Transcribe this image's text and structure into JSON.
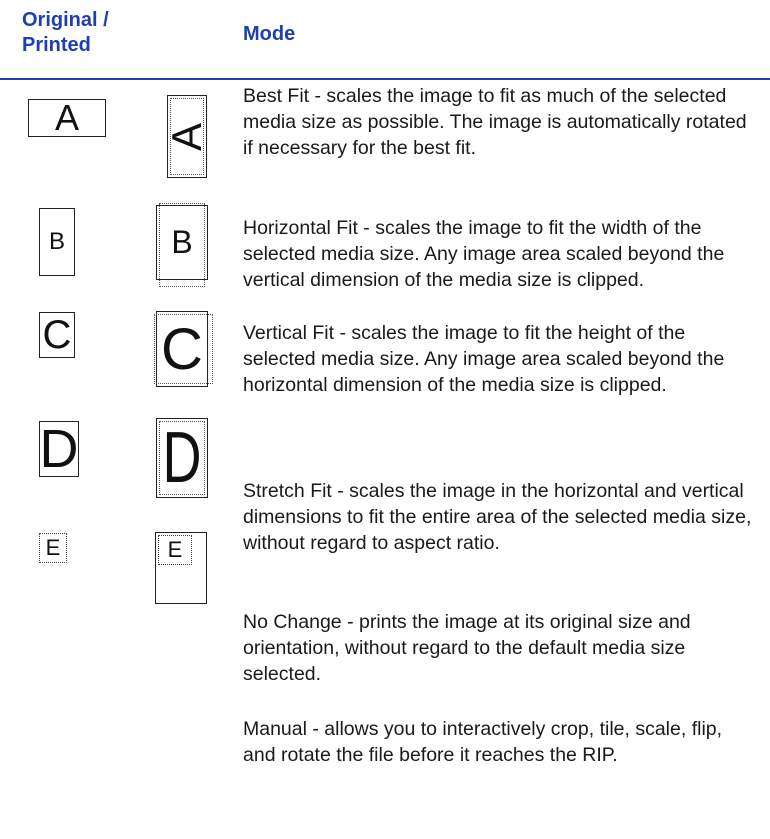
{
  "header": {
    "original_line1": "Original /",
    "original_line2": "Printed",
    "mode": "Mode"
  },
  "modes": [
    {
      "original_letter": "A",
      "printed_letter": "A",
      "description": "Best Fit - scales the image to fit as much of the selected media size as possible. The image is automatically rotated if necessary for the best fit."
    },
    {
      "original_letter": "B",
      "printed_letter": "B",
      "description": "Horizontal Fit - scales the image to fit the width of the selected media size. Any image area scaled beyond the vertical dimension of the media size is clipped."
    },
    {
      "original_letter": "C",
      "printed_letter": "C",
      "description": "Vertical Fit - scales the image to fit the height of the selected media size. Any image area scaled beyond the horizontal dimension of the media size is clipped."
    },
    {
      "original_letter": "D",
      "printed_letter": "D",
      "description": "Stretch Fit - scales the image in the horizontal and vertical dimensions to fit the entire area of the selected media size, without regard to aspect ratio."
    },
    {
      "original_letter": "E",
      "printed_letter": "E",
      "description": "No Change - prints the image at its original size and orientation, without regard to the default media size selected."
    },
    {
      "description": "Manual - allows you to interactively crop, tile, scale, flip, and rotate the file before it reaches the RIP."
    }
  ]
}
